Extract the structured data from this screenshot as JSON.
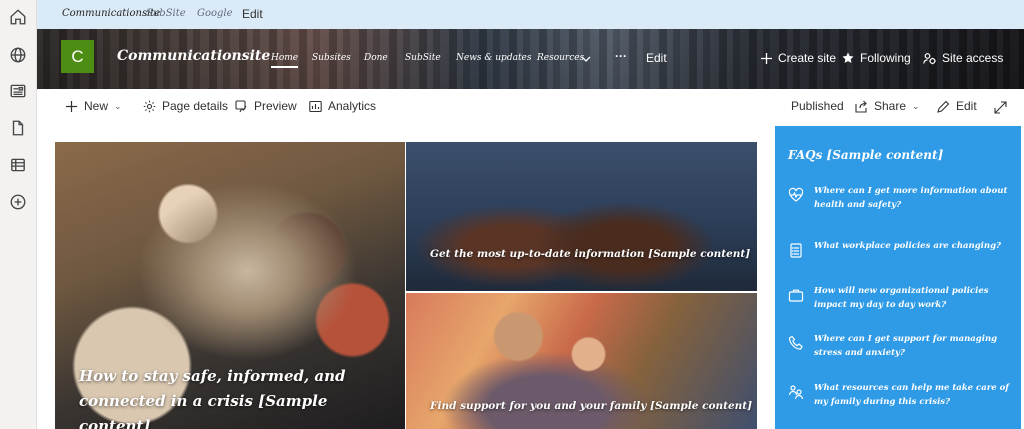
{
  "rail": {
    "icons": [
      "home-icon",
      "globe-icon",
      "news-icon",
      "document-icon",
      "list-icon",
      "add-icon"
    ]
  },
  "topbar": {
    "links": [
      "Communicationsite",
      "SubSite",
      "Google"
    ],
    "edit_label": "Edit"
  },
  "hero": {
    "logo_letter": "C",
    "site_title": "Communicationsite",
    "nav": [
      "Home",
      "Subsites",
      "Done",
      "SubSite",
      "News & updates",
      "Resources"
    ],
    "more_label": "···",
    "edit_label": "Edit",
    "create_site_label": "Create site",
    "following_label": "Following",
    "site_access_label": "Site access"
  },
  "commandbar": {
    "new_label": "New",
    "page_details_label": "Page details",
    "preview_label": "Preview",
    "analytics_label": "Analytics",
    "published_label": "Published",
    "share_label": "Share",
    "edit_label": "Edit"
  },
  "tiles": [
    {
      "caption": "How to stay safe, informed, and connected in a crisis [Sample content]"
    },
    {
      "caption": "Get the most up-to-date information [Sample content]"
    },
    {
      "caption": "Find support for you and your family [Sample content]"
    }
  ],
  "faq": {
    "title": "FAQs [Sample content]",
    "items": [
      {
        "icon": "heartbeat-icon",
        "text": "Where can I get more information about health and safety?"
      },
      {
        "icon": "clipboard-list-icon",
        "text": "What workplace policies are changing?"
      },
      {
        "icon": "briefcase-icon",
        "text": "How will new organizational policies impact my day to day work?"
      },
      {
        "icon": "phone-icon",
        "text": "Where can I get support for managing stress and anxiety?"
      },
      {
        "icon": "people-icon",
        "text": "What resources can help me take care of my family during this crisis?"
      }
    ]
  },
  "colors": {
    "accent_faq": "#2f9ae6",
    "logo_green": "#4e8d14",
    "topbar_bg": "#dbeaf7"
  }
}
